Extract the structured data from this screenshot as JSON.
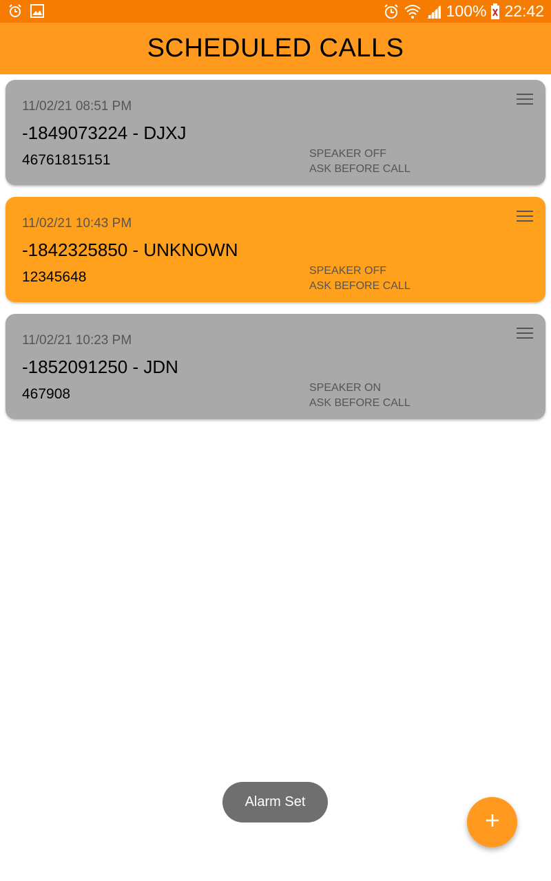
{
  "status_bar": {
    "battery": "100%",
    "time": "22:42",
    "icons": [
      "alarm-icon",
      "image-icon",
      "alarm-icon",
      "wifi-icon",
      "signal-icon",
      "battery-icon"
    ]
  },
  "app_bar": {
    "title": "SCHEDULED CALLS"
  },
  "calls": [
    {
      "datetime": "11/02/21 08:51 PM",
      "title": "-1849073224 - DJXJ",
      "number": "46761815151",
      "speaker": "SPEAKER OFF",
      "ask": "ASK BEFORE CALL",
      "color": "#a9a9a9"
    },
    {
      "datetime": "11/02/21 10:43 PM",
      "title": "-1842325850 - UNKNOWN",
      "number": "12345648",
      "speaker": "SPEAKER OFF",
      "ask": "ASK BEFORE CALL",
      "color": "#ffa11c"
    },
    {
      "datetime": "11/02/21 10:23 PM",
      "title": "-1852091250 - JDN",
      "number": "467908",
      "speaker": "SPEAKER ON",
      "ask": "ASK BEFORE CALL",
      "color": "#a9a9a9"
    }
  ],
  "toast": {
    "text": "Alarm Set"
  },
  "fab": {
    "icon": "plus-icon",
    "color": "#ff9a1e"
  }
}
